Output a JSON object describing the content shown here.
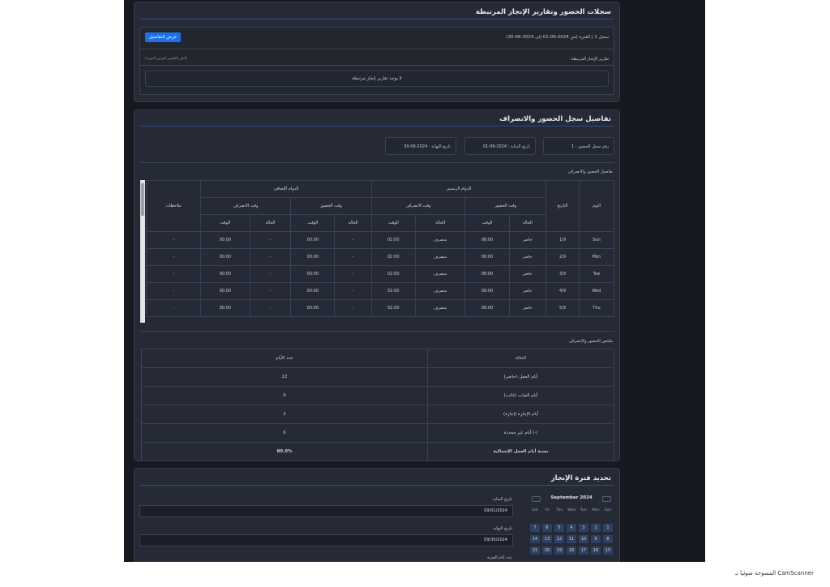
{
  "reports_card": {
    "title": "سجلات الحضور وتقارير الإنجاز المرتبطة",
    "record_line": "سجل 1 | الفترة (من 2024-09-01 إلى 2024-09-30)",
    "details_button": "عرض التفاصيل",
    "linked_reports_label": "تقارير الإنجاز المرتبطة:",
    "linked_reports_hint": "(انقر بالتقرير لعرض المزيد)",
    "no_reports": "لا يوجد تقارير إنجاز مرتبطة"
  },
  "details_card": {
    "title": "تفاصيل سجل الحضور والانصراف",
    "record_no_label": "رقم سجل الحضور :",
    "record_no_value": "1",
    "start_label": "تاريخ البداية :",
    "start_value": "2024-09-01",
    "end_label": "تاريخ النهاية :",
    "end_value": "2024-09-30",
    "section_label": "تفاصيل الحضور والانصراف",
    "table": {
      "h_day": "اليوم",
      "h_date": "التاريخ",
      "h_official": "الدوام الرسمي",
      "h_extra": "الدوام الإضافي",
      "h_notes": "ملاحظات",
      "h_checkin": "وقت الحضور",
      "h_checkout": "وقت الانصراف",
      "h_status": "الحالة",
      "h_time": "الوقت",
      "rows": [
        {
          "day": "Sun",
          "date": "1/9",
          "in_status": "حاضر",
          "in_time": "08:00",
          "out_status": "منصرف",
          "out_time": "02:00",
          "ex_in_status": "-",
          "ex_in_time": "00:00",
          "ex_out_status": "-",
          "ex_out_time": "00:00",
          "notes": "-"
        },
        {
          "day": "Mon",
          "date": "2/9",
          "in_status": "حاضر",
          "in_time": "08:00",
          "out_status": "منصرف",
          "out_time": "02:00",
          "ex_in_status": "-",
          "ex_in_time": "00:00",
          "ex_out_status": "-",
          "ex_out_time": "00:00",
          "notes": "-"
        },
        {
          "day": "Tue",
          "date": "3/9",
          "in_status": "حاضر",
          "in_time": "08:00",
          "out_status": "منصرف",
          "out_time": "02:00",
          "ex_in_status": "-",
          "ex_in_time": "00:00",
          "ex_out_status": "-",
          "ex_out_time": "00:00",
          "notes": "-"
        },
        {
          "day": "Wed",
          "date": "4/9",
          "in_status": "حاضر",
          "in_time": "08:00",
          "out_status": "منصرف",
          "out_time": "02:00",
          "ex_in_status": "-",
          "ex_in_time": "00:00",
          "ex_out_status": "-",
          "ex_out_time": "00:00",
          "notes": "-"
        },
        {
          "day": "Thu",
          "date": "5/9",
          "in_status": "حاضر",
          "in_time": "08:00",
          "out_status": "منصرف",
          "out_time": "02:00",
          "ex_in_status": "-",
          "ex_in_time": "00:00",
          "ex_out_status": "-",
          "ex_out_time": "00:00",
          "notes": "-"
        }
      ]
    },
    "summary_label": "ملخص الحضور والانصراف",
    "summary": {
      "h_status": "الحالة",
      "h_count": "عدد الأيام",
      "rows": [
        {
          "status": "أيام العمل (حاضر)",
          "count": "22"
        },
        {
          "status": "أيام الغياب (غائب)",
          "count": "0"
        },
        {
          "status": "أيام الإجازة (إجازة)",
          "count": "2"
        },
        {
          "status": "أيام غير محددة (-)",
          "count": "6"
        }
      ],
      "total_label": "نسبة أيام العمل الإجمالية",
      "total_value": "80.0%"
    }
  },
  "period_card": {
    "title": "تحديد فترة الإنجاز",
    "start_label": "تاريخ البداية",
    "start_value": "09/01/2024",
    "end_label": "تاريخ النهاية",
    "end_value": "09/30/2024",
    "days_label": "عدد أيام الفترة",
    "calendar": {
      "month": "September 2024",
      "prev_icon": "chevron-left-icon",
      "next_icon": "chevron-right-icon",
      "dow": [
        "Sat",
        "Fri",
        "Thu",
        "Wed",
        "Tue",
        "Mon",
        "Sun"
      ],
      "weeks": [
        [
          "7",
          "6",
          "5",
          "4",
          "3",
          "2",
          "1"
        ],
        [
          "14",
          "13",
          "12",
          "11",
          "10",
          "9",
          "8"
        ],
        [
          "21",
          "20",
          "19",
          "18",
          "17",
          "16",
          "15"
        ]
      ]
    }
  },
  "watermark": "المسوحة ضوئيا بـ CamScanner",
  "colors": {
    "accent": "#1f6feb",
    "card": "#252a36",
    "page": "#16191f",
    "title_rule": "#2f4e86"
  }
}
